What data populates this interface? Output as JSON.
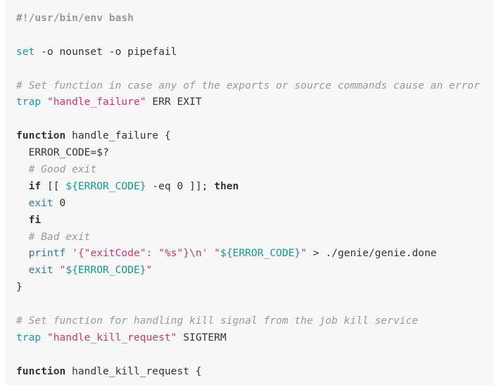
{
  "document": {
    "kind": "bash-script-code-block",
    "language": "bash",
    "colors": {
      "page_background": "#ffffff",
      "code_background": "#f7f7f7",
      "plain_text": "#333333",
      "comment": "#999999",
      "builtin": "#1a9aa6",
      "function_name": "#2b7bba",
      "string": "#d4356e",
      "variable": "#149b8e",
      "keyword": "#333333"
    }
  },
  "lines": [
    {
      "n": 1,
      "text": "#!/usr/bin/env bash",
      "tokens": [
        {
          "t": "#!/usr/bin/env bash",
          "c": "tok-shebang"
        }
      ]
    },
    {
      "n": 2,
      "text": "",
      "tokens": []
    },
    {
      "n": 3,
      "text": "set -o nounset -o pipefail",
      "tokens": [
        {
          "t": "set",
          "c": "tok-builtin"
        },
        {
          "t": " -o nounset -o pipefail",
          "c": "tok-plain"
        }
      ]
    },
    {
      "n": 4,
      "text": "",
      "tokens": []
    },
    {
      "n": 5,
      "text": "# Set function in case any of the exports or source commands cause an error",
      "tokens": [
        {
          "t": "# Set function in case any of the exports or source commands cause an error",
          "c": "tok-comment"
        }
      ]
    },
    {
      "n": 6,
      "text": "trap \"handle_failure\" ERR EXIT",
      "tokens": [
        {
          "t": "trap",
          "c": "tok-builtin"
        },
        {
          "t": " ",
          "c": "tok-plain"
        },
        {
          "t": "\"handle_failure\"",
          "c": "tok-string"
        },
        {
          "t": " ERR EXIT",
          "c": "tok-plain"
        }
      ]
    },
    {
      "n": 7,
      "text": "",
      "tokens": []
    },
    {
      "n": 8,
      "text": "function handle_failure {",
      "tokens": [
        {
          "t": "function",
          "c": "tok-keyword"
        },
        {
          "t": " handle_failure {",
          "c": "tok-plain"
        }
      ]
    },
    {
      "n": 9,
      "text": "  ERROR_CODE=$?",
      "tokens": [
        {
          "t": "  ERROR_CODE=$?",
          "c": "tok-plain"
        }
      ]
    },
    {
      "n": 10,
      "text": "  # Good exit",
      "tokens": [
        {
          "t": "  ",
          "c": "tok-plain"
        },
        {
          "t": "# Good exit",
          "c": "tok-comment"
        }
      ]
    },
    {
      "n": 11,
      "text": "  if [[ ${ERROR_CODE} -eq 0 ]]; then",
      "tokens": [
        {
          "t": "  ",
          "c": "tok-plain"
        },
        {
          "t": "if",
          "c": "tok-keyword"
        },
        {
          "t": " [[ ",
          "c": "tok-plain"
        },
        {
          "t": "${ERROR_CODE}",
          "c": "tok-var"
        },
        {
          "t": " -eq 0 ]]; ",
          "c": "tok-plain"
        },
        {
          "t": "then",
          "c": "tok-keyword"
        }
      ]
    },
    {
      "n": 12,
      "text": "  exit 0",
      "tokens": [
        {
          "t": "  ",
          "c": "tok-plain"
        },
        {
          "t": "exit",
          "c": "tok-func"
        },
        {
          "t": " 0",
          "c": "tok-plain"
        }
      ]
    },
    {
      "n": 13,
      "text": "  fi",
      "tokens": [
        {
          "t": "  ",
          "c": "tok-plain"
        },
        {
          "t": "fi",
          "c": "tok-keyword"
        }
      ]
    },
    {
      "n": 14,
      "text": "  # Bad exit",
      "tokens": [
        {
          "t": "  ",
          "c": "tok-plain"
        },
        {
          "t": "# Bad exit",
          "c": "tok-comment"
        }
      ]
    },
    {
      "n": 15,
      "text": "  printf '{\"exitCode\": \"%s\"}\\n' \"${ERROR_CODE}\" > ./genie/genie.done",
      "tokens": [
        {
          "t": "  ",
          "c": "tok-plain"
        },
        {
          "t": "printf",
          "c": "tok-func"
        },
        {
          "t": " ",
          "c": "tok-plain"
        },
        {
          "t": "'{\"exitCode\": \"%s\"}\\n'",
          "c": "tok-string"
        },
        {
          "t": " ",
          "c": "tok-plain"
        },
        {
          "t": "\"",
          "c": "tok-string"
        },
        {
          "t": "${ERROR_CODE}",
          "c": "tok-var"
        },
        {
          "t": "\"",
          "c": "tok-string"
        },
        {
          "t": " > ./genie/genie.done",
          "c": "tok-plain"
        }
      ]
    },
    {
      "n": 16,
      "text": "  exit \"${ERROR_CODE}\"",
      "tokens": [
        {
          "t": "  ",
          "c": "tok-plain"
        },
        {
          "t": "exit",
          "c": "tok-func"
        },
        {
          "t": " ",
          "c": "tok-plain"
        },
        {
          "t": "\"",
          "c": "tok-string"
        },
        {
          "t": "${ERROR_CODE}",
          "c": "tok-var"
        },
        {
          "t": "\"",
          "c": "tok-string"
        }
      ]
    },
    {
      "n": 17,
      "text": "}",
      "tokens": [
        {
          "t": "}",
          "c": "tok-plain"
        }
      ]
    },
    {
      "n": 18,
      "text": "",
      "tokens": []
    },
    {
      "n": 19,
      "text": "# Set function for handling kill signal from the job kill service",
      "tokens": [
        {
          "t": "# Set function for handling kill signal from the job kill service",
          "c": "tok-comment"
        }
      ]
    },
    {
      "n": 20,
      "text": "trap \"handle_kill_request\" SIGTERM",
      "tokens": [
        {
          "t": "trap",
          "c": "tok-builtin"
        },
        {
          "t": " ",
          "c": "tok-plain"
        },
        {
          "t": "\"handle_kill_request\"",
          "c": "tok-string"
        },
        {
          "t": " SIGTERM",
          "c": "tok-plain"
        }
      ]
    },
    {
      "n": 21,
      "text": "",
      "tokens": []
    },
    {
      "n": 22,
      "text": "function handle_kill_request {",
      "tokens": [
        {
          "t": "function",
          "c": "tok-keyword"
        },
        {
          "t": " handle_kill_request {",
          "c": "tok-plain"
        }
      ]
    }
  ]
}
